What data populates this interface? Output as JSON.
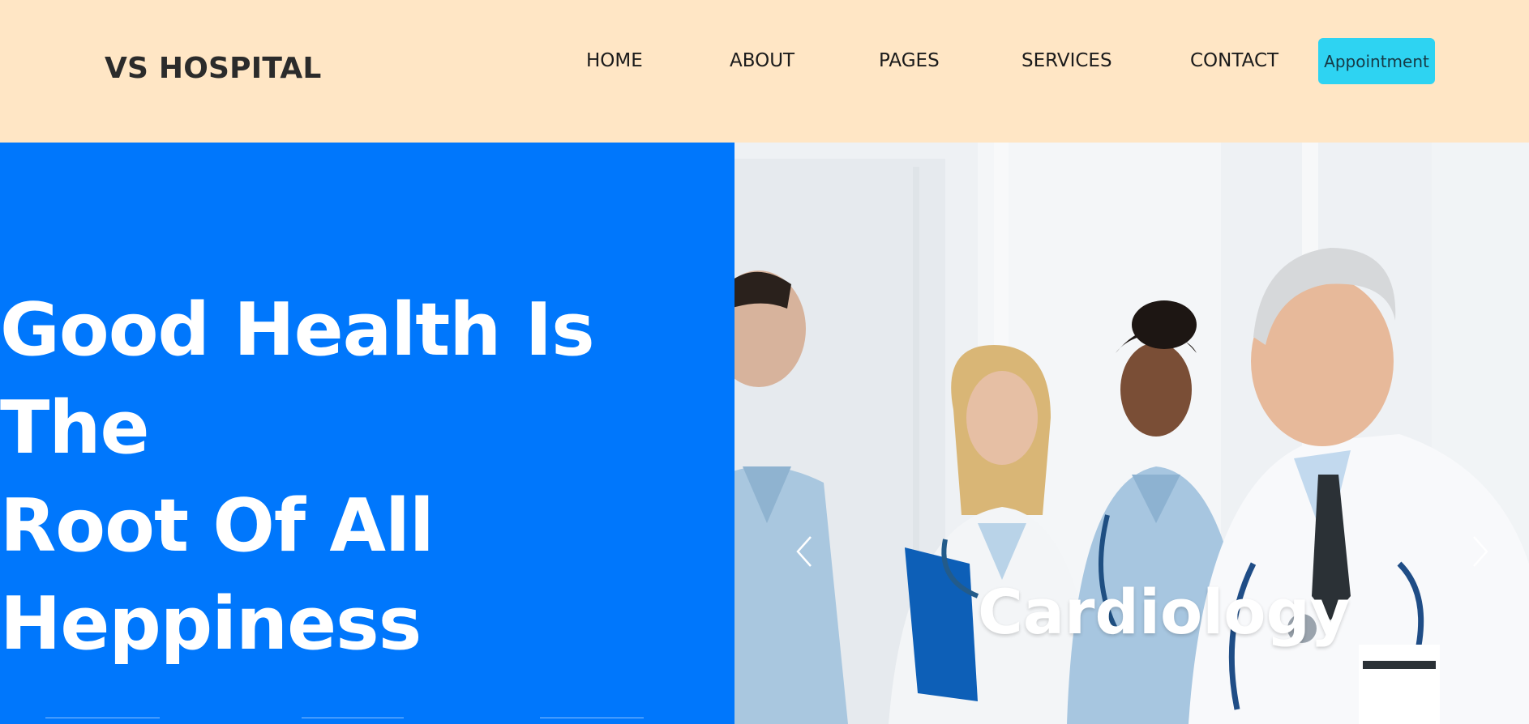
{
  "header": {
    "brand": "VS HOSPITAL",
    "nav": [
      "HOME",
      "ABOUT",
      "PAGES",
      "SERVICES",
      "CONTACT"
    ],
    "cta_label": "Appointment",
    "background_color": "#ffe6c5",
    "cta_color": "#2ed3f2"
  },
  "hero": {
    "headline_lines": [
      "Good Health Is The",
      "Root Of All",
      "Heppiness"
    ],
    "background_color": "#0077fc",
    "slide_caption": "Cardiology",
    "prev_icon": "chevron-left-icon",
    "next_icon": "chevron-right-icon"
  }
}
